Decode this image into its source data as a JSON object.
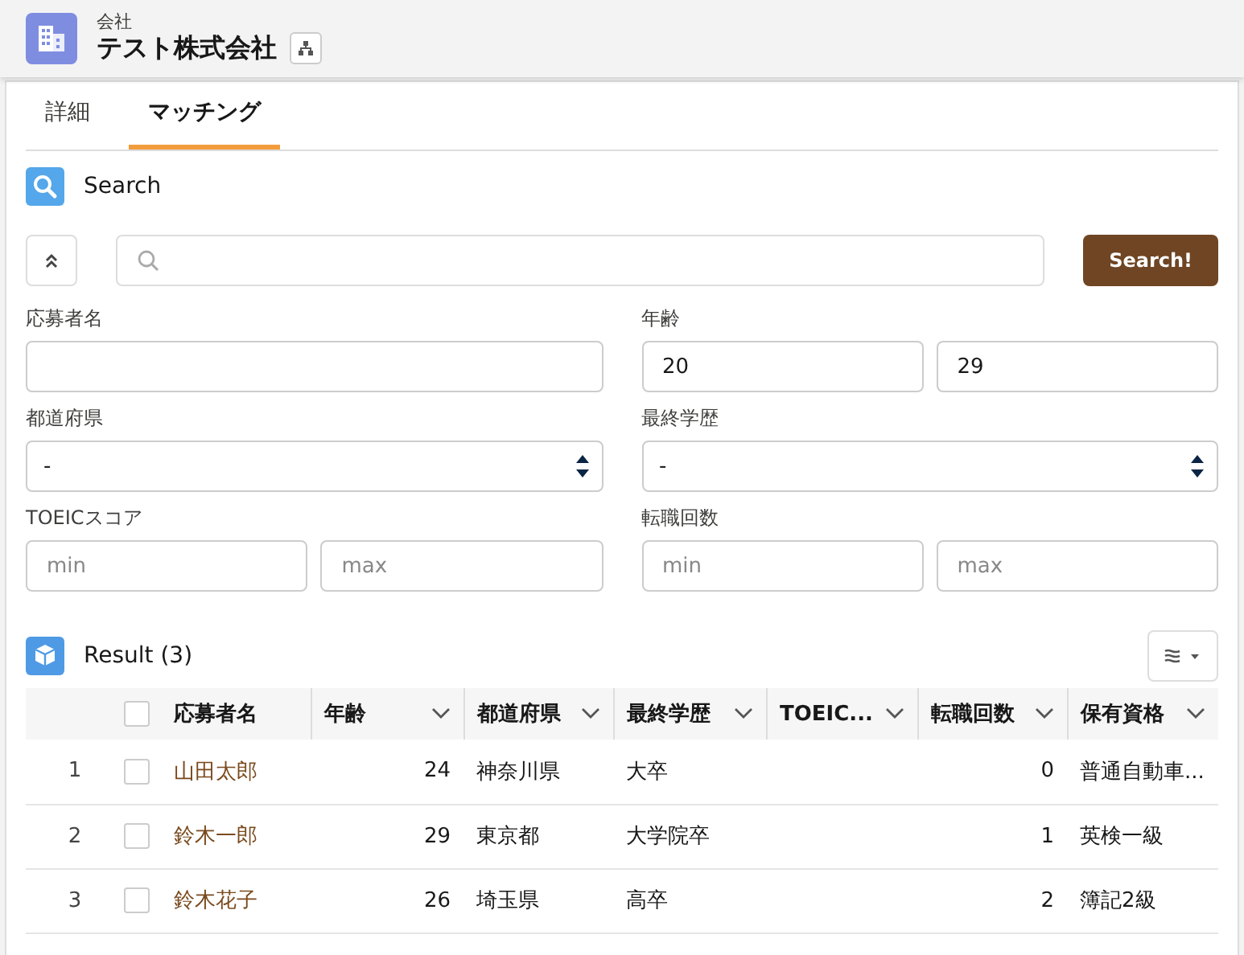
{
  "header": {
    "object_type": "会社",
    "title": "テスト株式会社"
  },
  "tabs": [
    {
      "label": "詳細",
      "selected": false
    },
    {
      "label": "マッチング",
      "selected": true
    }
  ],
  "search_section": {
    "title": "Search",
    "search_button": "Search!",
    "filters": [
      {
        "label": "応募者名",
        "kind": "text"
      },
      {
        "label": "年齢",
        "kind": "range",
        "fields": [
          {
            "value": "20"
          },
          {
            "value": "29"
          }
        ]
      },
      {
        "label": "都道府県",
        "kind": "select",
        "fields": [
          {
            "value": "-"
          }
        ]
      },
      {
        "label": "最終学歴",
        "kind": "select",
        "fields": [
          {
            "value": "-"
          }
        ]
      },
      {
        "label": "TOEICスコア",
        "kind": "range",
        "fields": [
          {
            "placeholder": "min"
          },
          {
            "placeholder": "max"
          }
        ]
      },
      {
        "label": "転職回数",
        "kind": "range",
        "fields": [
          {
            "placeholder": "min"
          },
          {
            "placeholder": "max"
          }
        ]
      }
    ]
  },
  "result_section": {
    "title": "Result (3)",
    "table": {
      "select_all_checked": false,
      "columns": [
        {
          "label": "応募者名",
          "sortable": false
        },
        {
          "label": "年齢",
          "sortable": true
        },
        {
          "label": "都道府県",
          "sortable": true
        },
        {
          "label": "最終学歴",
          "sortable": true
        },
        {
          "label": "TOEIC...",
          "sortable": true
        },
        {
          "label": "転職回数",
          "sortable": true
        },
        {
          "label": "保有資格",
          "sortable": true
        }
      ],
      "rows": [
        {
          "number": "1",
          "checked": false,
          "cells": [
            "山田太郎",
            "24",
            "神奈川県",
            "大卒",
            "",
            "0",
            "普通自動車..."
          ]
        },
        {
          "number": "2",
          "checked": false,
          "cells": [
            "鈴木一郎",
            "29",
            "東京都",
            "大学院卒",
            "",
            "1",
            "英検一級"
          ]
        },
        {
          "number": "3",
          "checked": false,
          "cells": [
            "鈴木花子",
            "26",
            "埼玉県",
            "高卒",
            "",
            "2",
            "簿記2級"
          ]
        }
      ]
    }
  }
}
